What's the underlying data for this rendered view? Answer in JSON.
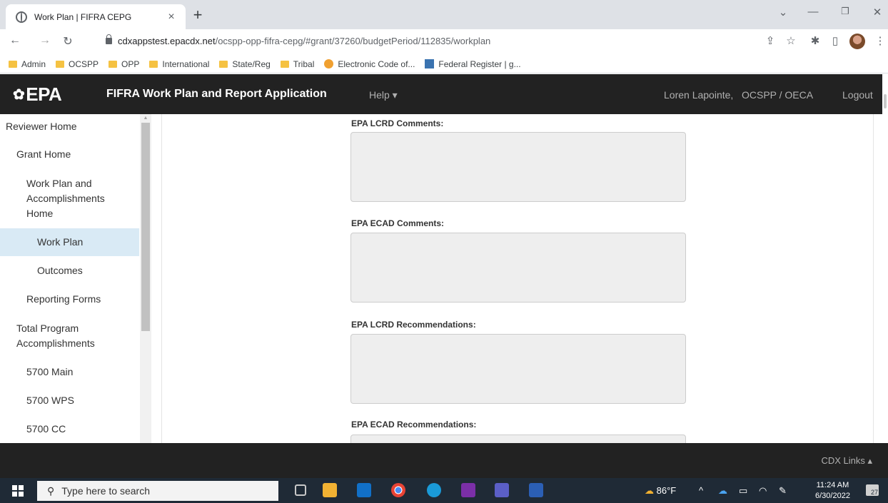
{
  "browser": {
    "tab_title": "Work Plan | FIFRA CEPG",
    "tab_close": "×",
    "new_tab": "+",
    "url_host": "cdxappstest.epacdx.net",
    "url_path": "/ocspp-opp-fifra-cepg/#grant/37260/budgetPeriod/112835/workplan",
    "bookmarks": [
      {
        "label": "Admin",
        "icon": "folder-icon"
      },
      {
        "label": "OCSPP",
        "icon": "folder-icon"
      },
      {
        "label": "OPP",
        "icon": "folder-icon"
      },
      {
        "label": "International",
        "icon": "folder-icon"
      },
      {
        "label": "State/Reg",
        "icon": "folder-icon"
      },
      {
        "label": "Tribal",
        "icon": "folder-icon"
      },
      {
        "label": "Electronic Code of...",
        "icon": "ecfr-icon"
      },
      {
        "label": "Federal Register | g...",
        "icon": "federal-register-icon"
      }
    ]
  },
  "header": {
    "logo": "EPA",
    "app_title": "FIFRA Work Plan and Report Application",
    "help": "Help ▾",
    "user": "Loren Lapointe,",
    "org": "OCSPP / OECA",
    "logout": "Logout"
  },
  "sidebar": {
    "items": [
      {
        "label": "Reviewer Home",
        "active": false
      },
      {
        "label": "Grant Home",
        "active": false
      },
      {
        "label": "Work Plan and Accomplishments Home",
        "active": false
      },
      {
        "label": "Work Plan",
        "active": true
      },
      {
        "label": "Outcomes",
        "active": false
      },
      {
        "label": "Reporting Forms",
        "active": false
      },
      {
        "label": "Total Program Accomplishments",
        "active": false
      },
      {
        "label": "5700 Main",
        "active": false
      },
      {
        "label": "5700 WPS",
        "active": false
      },
      {
        "label": "5700 CC",
        "active": false
      }
    ]
  },
  "main": {
    "fields": [
      {
        "label": "EPA LCRD Comments:",
        "value": ""
      },
      {
        "label": "EPA ECAD Comments:",
        "value": ""
      },
      {
        "label": "EPA LCRD Recommendations:",
        "value": ""
      },
      {
        "label": "EPA ECAD Recommendations:",
        "value": ""
      }
    ]
  },
  "footer": {
    "cdx_links": "CDX Links ▴"
  },
  "taskbar": {
    "search_placeholder": "Type here to search",
    "weather": "86°F",
    "time": "11:24 AM",
    "date": "6/30/2022",
    "notifications": "27"
  },
  "colors": {
    "header_bg": "#222222",
    "active_nav": "#d9eaf5",
    "field_bg": "#eeeeee"
  }
}
